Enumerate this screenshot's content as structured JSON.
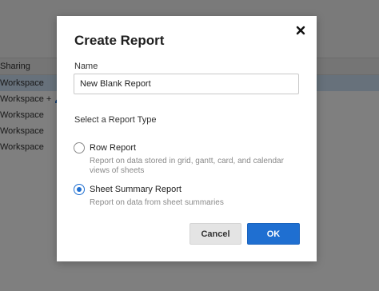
{
  "background": {
    "rows": [
      {
        "label": "Sharing",
        "style": "header"
      },
      {
        "label": "Workspace",
        "style": "selected"
      },
      {
        "label": "Workspace +",
        "style": "normal",
        "icon": "person-icon"
      },
      {
        "label": "Workspace",
        "style": "normal"
      },
      {
        "label": "Workspace",
        "style": "normal"
      },
      {
        "label": "Workspace",
        "style": "normal"
      }
    ]
  },
  "modal": {
    "title": "Create Report",
    "close_icon": "close-icon",
    "name_label": "Name",
    "name_value": "New Blank Report",
    "type_label": "Select a Report Type",
    "options": [
      {
        "title": "Row Report",
        "description": "Report on data stored in grid, gantt, card, and calendar views of sheets",
        "checked": false
      },
      {
        "title": "Sheet Summary Report",
        "description": "Report on data from sheet summaries",
        "checked": true
      }
    ],
    "cancel_label": "Cancel",
    "ok_label": "OK"
  },
  "colors": {
    "accent": "#1f6fd1",
    "overlay": "rgba(0,0,0,0.5)"
  }
}
